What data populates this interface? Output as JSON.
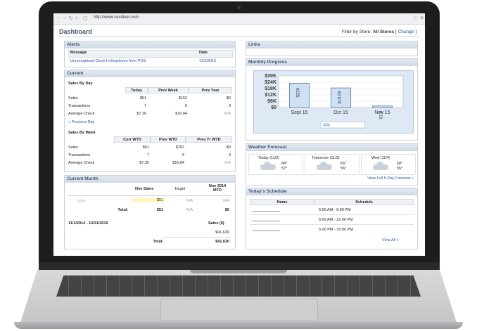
{
  "browser": {
    "url": "http://www.ncrsilver.com"
  },
  "header": {
    "title": "Dashboard",
    "filter_prefix": "Filter by Store:",
    "filter_value": "All Stores",
    "change_link": "Change"
  },
  "alerts": {
    "title": "Alerts",
    "columns": [
      "Message",
      "Date"
    ],
    "rows": [
      {
        "message": "Unrecognized Clock-In Employee from POS",
        "date": "11/2/2015"
      }
    ]
  },
  "current": {
    "title": "Current",
    "sales_by_day": {
      "title": "Sales By Day",
      "columns": [
        "Today",
        "Prev Week",
        "Prev Year"
      ],
      "rows": [
        {
          "label": "Sales",
          "values": [
            "$51",
            "$152",
            "$0"
          ]
        },
        {
          "label": "Transactions",
          "values": [
            "7",
            "9",
            "0"
          ]
        },
        {
          "label": "Average Check",
          "values": [
            "$7.36",
            "$16.84",
            "N/A"
          ]
        }
      ],
      "prev_link": "Previous Day"
    },
    "sales_by_week": {
      "title": "Sales By Week",
      "columns": [
        "Curr WTD",
        "Prev WTD",
        "Prev Yr WTD"
      ],
      "rows": [
        {
          "label": "Sales",
          "values": [
            "$51",
            "$152",
            "$0"
          ]
        },
        {
          "label": "Transactions",
          "values": [
            "7",
            "9",
            "0"
          ]
        },
        {
          "label": "Average Check",
          "values": [
            "$7.35",
            "$16.84",
            "N/A"
          ]
        }
      ]
    }
  },
  "current_month": {
    "title": "Current Month",
    "columns": [
      "Nov Sales",
      "Target",
      "Nov 2014 MTD"
    ],
    "row_label": "12/24",
    "row_values": [
      "$51",
      "N/A",
      "N/A"
    ],
    "total_label": "Total:",
    "total_values": [
      "$51",
      "N/A",
      "$0"
    ],
    "period_label": "11/1/2014 - 10/31/2015",
    "sales_header": "Sales ($)",
    "period_value": "$41,630",
    "period_total_label": "Total:",
    "period_total": "$41,630"
  },
  "links": {
    "title": "Links"
  },
  "monthly_progress": {
    "title": "Monthly Progress",
    "chart_data": {
      "type": "bar",
      "categories": [
        "Sept 15",
        "Oct 15",
        "Nov 15"
      ],
      "values": [
        23,
        18.6,
        1.5
      ],
      "bar_labels": [
        "$23K",
        "$18.6K",
        "$1.5"
      ],
      "yticks": [
        "$30K",
        "$24K",
        "$18K",
        "$12K",
        "$6K",
        "$0"
      ],
      "ylim": [
        0,
        30
      ],
      "legend": "top-left below chart"
    }
  },
  "weather": {
    "title": "Weather Forecast",
    "days": [
      {
        "label": "Today (11/2)",
        "high": "84°",
        "low": "57°"
      },
      {
        "label": "Tomorrow (11/3)",
        "high": "65°",
        "low": "56°"
      },
      {
        "label": "Wed (11/4)",
        "high": "68°",
        "low": "55°"
      }
    ],
    "link": "View Full 5-Day Forecast »"
  },
  "schedule": {
    "title": "Today's Schedule",
    "columns": [
      "Name",
      "Schedule"
    ],
    "rows": [
      "6:00 AM - 6:00 PM",
      "6:00 AM - 12:00 PM",
      "5:00 PM - 10:00 PM"
    ],
    "link": "View All »"
  },
  "colors": {
    "accent": "#2454a6",
    "header_text": "#3f556e",
    "chart_bg": "#dfe9f5",
    "bar_fill": "#cfe0f2"
  }
}
